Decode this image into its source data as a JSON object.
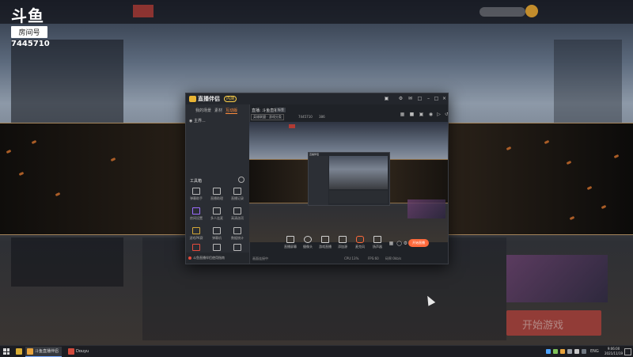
{
  "brand": {
    "logo_text": "斗鱼",
    "room_label": "房间号",
    "room_number": "7445710"
  },
  "background": {
    "promo_button": "开始游戏"
  },
  "app": {
    "name": "直播伴侣",
    "version_badge": "内测",
    "titlebar_icons": [
      "shirt-icon",
      "settings-icon",
      "mail-icon",
      "message-icon",
      "minimize-icon",
      "maximize-icon",
      "close-icon"
    ],
    "left_tabs": [
      {
        "label": "我的场景"
      },
      {
        "label": "素材"
      },
      {
        "label": "互动版",
        "active": true
      }
    ],
    "scene": {
      "label": "主界..."
    },
    "tools_title": "工具箱",
    "tools": [
      {
        "label": "弹幕助手"
      },
      {
        "label": "直播助理"
      },
      {
        "label": "直播记录"
      },
      {
        "label": "房间设置"
      },
      {
        "label": "多人连麦"
      },
      {
        "label": "高清选项"
      },
      {
        "label": "游戏PK赛"
      },
      {
        "label": "弹幕机"
      },
      {
        "label": "数据统计"
      },
      {
        "label": "直播录制"
      },
      {
        "label": "设置"
      },
      {
        "label": "更多"
      }
    ],
    "promo_text": "斗鱼直播伴侣使用指南",
    "room_title": "直播: 斗鱼直播",
    "room_tag": "标签",
    "category": "英雄联盟 · 游戏分类",
    "room_id_text": "7445710",
    "viewer_count": "386",
    "right_icons": [
      "layout-icon",
      "bag-icon",
      "gift-icon",
      "eye-icon",
      "bell-icon",
      "share-icon"
    ],
    "nested_title": "直播伴侣",
    "toolbar": [
      {
        "label": "直播屏幕"
      },
      {
        "label": "摄像头"
      },
      {
        "label": "游戏直播"
      },
      {
        "label": "添加源"
      },
      {
        "label": "麦克风"
      },
      {
        "label": "扬声器"
      }
    ],
    "go_live": "开始直播",
    "status": {
      "left": "画面连接中",
      "cpu": "CPU:13%",
      "fps": "FPS:60",
      "bitrate": "码率:0kb/s"
    }
  },
  "taskbar": {
    "apps": [
      {
        "label": "斗鱼直播伴侣",
        "active": true
      },
      {
        "label": "Douyu",
        "active": false
      }
    ],
    "tray_lang": "ENG",
    "time": "9:06:00",
    "date": "2021/11/19"
  }
}
